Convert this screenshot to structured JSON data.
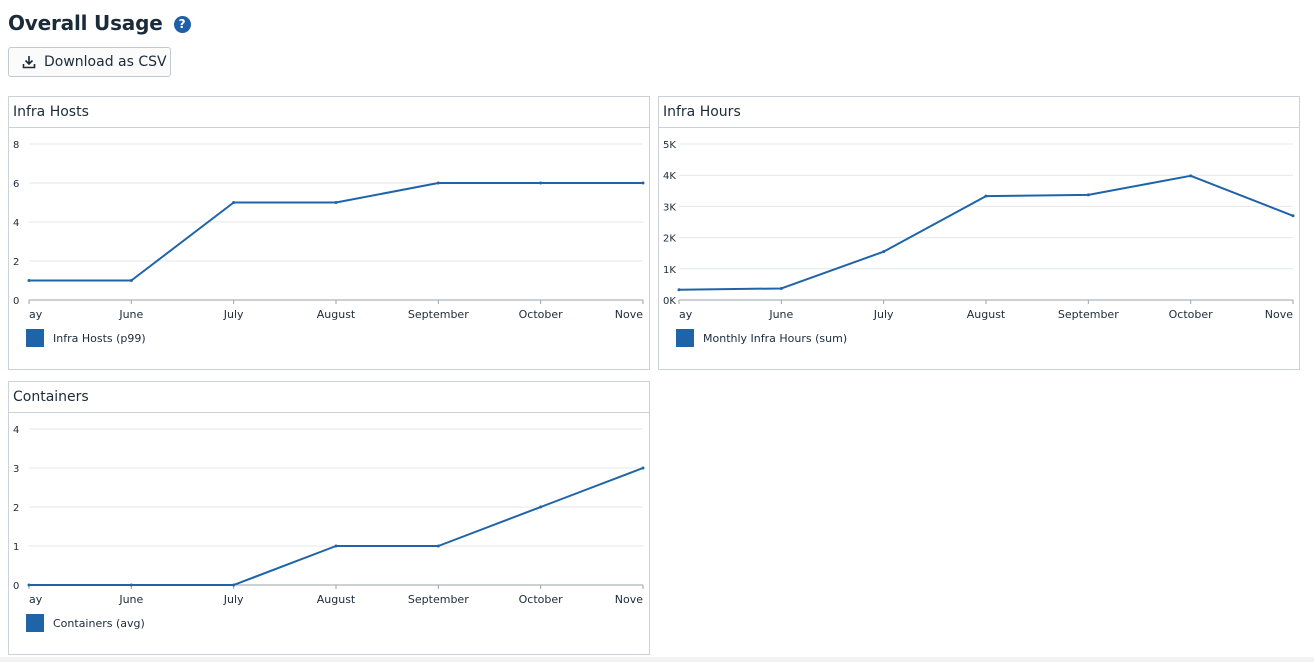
{
  "page": {
    "title": "Overall Usage",
    "help_icon": "question-circle-icon",
    "download_label": "Download as CSV",
    "download_icon": "download-icon"
  },
  "colors": {
    "series": "#1f64a8",
    "grid": "#e4e7eb",
    "axis": "#9aa3ad",
    "text": "#1c2b39"
  },
  "charts": [
    {
      "title": "Infra Hosts",
      "legend": "Infra Hosts (p99)",
      "chart_data": {
        "type": "line",
        "x": [
          "May",
          "June",
          "July",
          "August",
          "September",
          "October",
          "November"
        ],
        "x_tick_labels": [
          "ay",
          "June",
          "July",
          "August",
          "September",
          "October",
          "Nove"
        ],
        "series": [
          {
            "name": "Infra Hosts (p99)",
            "values": [
              1,
              1,
              5,
              5,
              6,
              6,
              6
            ]
          }
        ],
        "ylim": [
          0,
          8
        ],
        "y_ticks": [
          0,
          2,
          4,
          6,
          8
        ],
        "y_tick_labels": [
          "0",
          "2",
          "4",
          "6",
          "8"
        ],
        "grid": true
      }
    },
    {
      "title": "Infra Hours",
      "legend": "Monthly Infra Hours (sum)",
      "chart_data": {
        "type": "line",
        "x": [
          "May",
          "June",
          "July",
          "August",
          "September",
          "October",
          "November"
        ],
        "x_tick_labels": [
          "ay",
          "June",
          "July",
          "August",
          "September",
          "October",
          "Nove"
        ],
        "series": [
          {
            "name": "Monthly Infra Hours (sum)",
            "values": [
              330,
              370,
              1550,
              3330,
              3370,
              3980,
              2700
            ]
          }
        ],
        "ylim": [
          0,
          5000
        ],
        "y_ticks": [
          0,
          1000,
          2000,
          3000,
          4000,
          5000
        ],
        "y_tick_labels": [
          "0K",
          "1K",
          "2K",
          "3K",
          "4K",
          "5K"
        ],
        "grid": true
      }
    },
    {
      "title": "Containers",
      "legend": "Containers (avg)",
      "chart_data": {
        "type": "line",
        "x": [
          "May",
          "June",
          "July",
          "August",
          "September",
          "October",
          "November"
        ],
        "x_tick_labels": [
          "ay",
          "June",
          "July",
          "August",
          "September",
          "October",
          "Nove"
        ],
        "series": [
          {
            "name": "Containers (avg)",
            "values": [
              0,
              0,
              0,
              1,
              1,
              2,
              3
            ]
          }
        ],
        "ylim": [
          0,
          4
        ],
        "y_ticks": [
          0,
          1,
          2,
          3,
          4
        ],
        "y_tick_labels": [
          "0",
          "1",
          "2",
          "3",
          "4"
        ],
        "grid": true
      }
    }
  ]
}
